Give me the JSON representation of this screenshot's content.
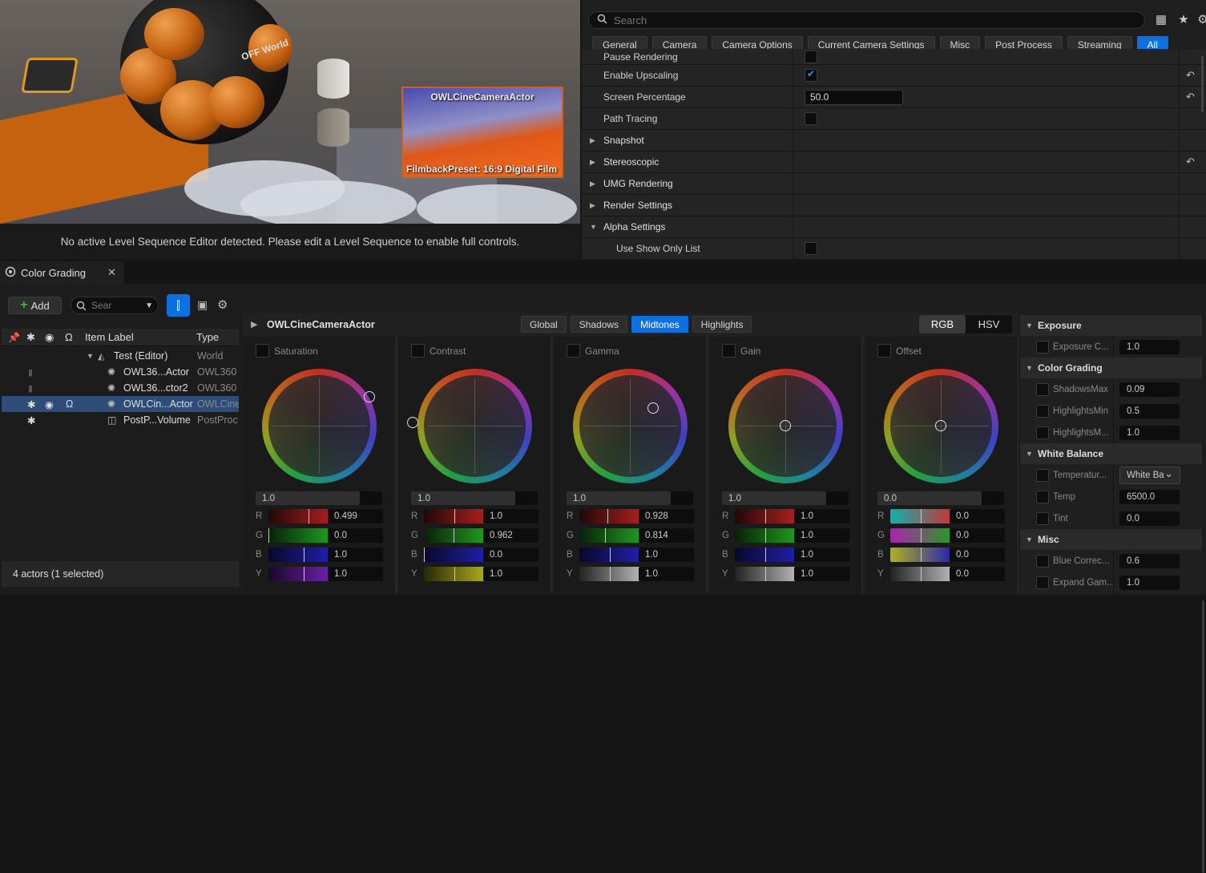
{
  "viewport": {
    "pip_title": "OWLCineCameraActor",
    "pip_filmback": "FilmbackPreset: 16:9 Digital Film",
    "sphere_text": "OFF World",
    "sequence_message": "No active Level Sequence Editor detected. Please edit a Level Sequence to enable full controls."
  },
  "details": {
    "search_placeholder": "Search",
    "filter_tabs": [
      "General",
      "Camera",
      "Camera Options",
      "Current Camera Settings",
      "Misc",
      "Post Process",
      "Streaming",
      "All"
    ],
    "active_filter": "All",
    "properties": [
      {
        "label": "Pause Rendering",
        "kind": "checkbox",
        "checked": false
      },
      {
        "label": "Enable Upscaling",
        "kind": "checkbox",
        "checked": true,
        "reset": true
      },
      {
        "label": "Screen Percentage",
        "kind": "number",
        "value": "50.0",
        "reset": true
      },
      {
        "label": "Path Tracing",
        "kind": "checkbox",
        "checked": false
      },
      {
        "label": "Snapshot",
        "kind": "category"
      },
      {
        "label": "Stereoscopic",
        "kind": "category",
        "reset": true
      },
      {
        "label": "UMG Rendering",
        "kind": "category"
      },
      {
        "label": "Render Settings",
        "kind": "category"
      },
      {
        "label": "Alpha Settings",
        "kind": "category-open"
      },
      {
        "label": "Use Show Only List",
        "kind": "checkbox-sub",
        "checked": false
      }
    ]
  },
  "tab": {
    "title": "Color Grading"
  },
  "outliner": {
    "add_label": "Add",
    "search_placeholder": "Sear",
    "col_label": "Item Label",
    "col_type": "Type",
    "rows": [
      {
        "name": "Test (Editor)",
        "type": "World"
      },
      {
        "name": "OWL36...Actor",
        "type": "OWL360"
      },
      {
        "name": "OWL36...ctor2",
        "type": "OWL360"
      },
      {
        "name": "OWLCin...Actor",
        "type": "OWLCine"
      },
      {
        "name": "PostP...Volume",
        "type": "PostProc"
      }
    ],
    "status": "4 actors (1 selected)"
  },
  "grading": {
    "actor": "OWLCineCameraActor",
    "range_tabs": [
      "Global",
      "Shadows",
      "Midtones",
      "Highlights"
    ],
    "active_range": "Midtones",
    "mode_tabs": [
      "RGB",
      "HSV"
    ],
    "active_mode": "RGB",
    "wheels": [
      {
        "name": "Saturation",
        "lum": "1.0",
        "r": "0.499",
        "g": "0.0",
        "b": "1.0",
        "y": "1.0"
      },
      {
        "name": "Contrast",
        "lum": "1.0",
        "r": "1.0",
        "g": "0.962",
        "b": "0.0",
        "y": "1.0"
      },
      {
        "name": "Gamma",
        "lum": "1.0",
        "r": "0.928",
        "g": "0.814",
        "b": "1.0",
        "y": "1.0"
      },
      {
        "name": "Gain",
        "lum": "1.0",
        "r": "1.0",
        "g": "1.0",
        "b": "1.0",
        "y": "1.0"
      },
      {
        "name": "Offset",
        "lum": "0.0",
        "r": "0.0",
        "g": "0.0",
        "b": "0.0",
        "y": "0.0"
      }
    ],
    "channel_labels": [
      "R",
      "G",
      "B",
      "Y"
    ]
  },
  "right_panel": {
    "sections": [
      {
        "title": "Exposure",
        "rows": [
          {
            "label": "Exposure C...",
            "value": "1.0"
          }
        ]
      },
      {
        "title": "Color Grading",
        "rows": [
          {
            "label": "ShadowsMax",
            "value": "0.09"
          },
          {
            "label": "HighlightsMin",
            "value": "0.5"
          },
          {
            "label": "HighlightsM...",
            "value": "1.0"
          }
        ]
      },
      {
        "title": "White Balance",
        "rows": [
          {
            "label": "Temperatur...",
            "value": "White Ba",
            "dropdown": true
          },
          {
            "label": "Temp",
            "value": "6500.0"
          },
          {
            "label": "Tint",
            "value": "0.0"
          }
        ]
      },
      {
        "title": "Misc",
        "rows": [
          {
            "label": "Blue Correc...",
            "value": "0.6"
          },
          {
            "label": "Expand Gam...",
            "value": "1.0"
          }
        ]
      }
    ]
  }
}
